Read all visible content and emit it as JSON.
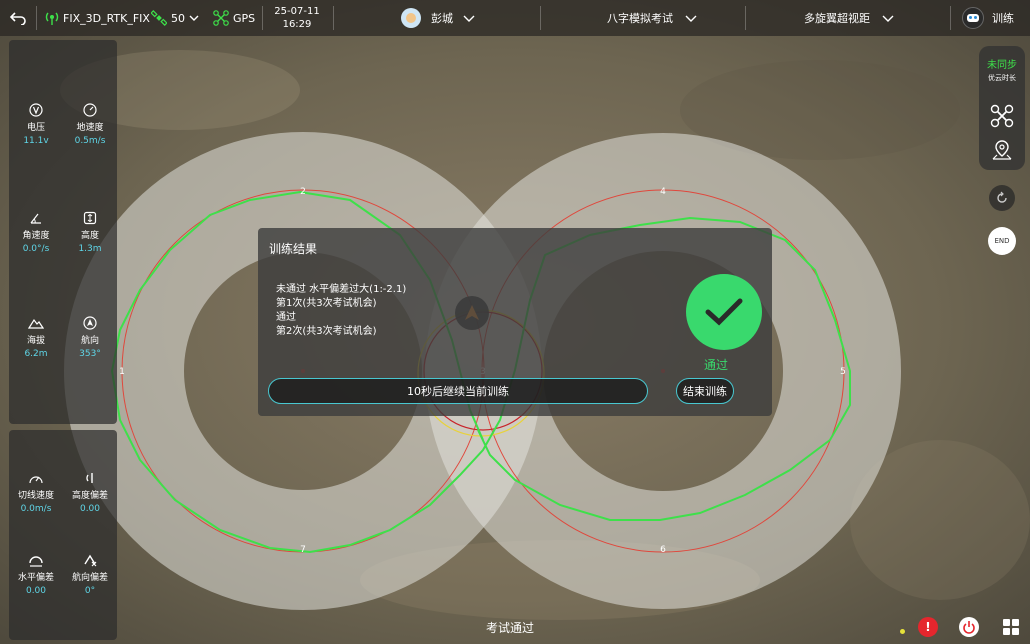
{
  "topbar": {
    "back_icon": "back-arrow-icon",
    "rtk_status": "FIX_3D_RTK_FIX",
    "satellite_count": "50",
    "gps_label": "GPS",
    "date": "25-07-11",
    "time": "16:29",
    "user_name": "彭城",
    "exam_mode": "八字模拟考试",
    "drone_view": "多旋翼超视距",
    "training_label": "训练"
  },
  "left_panel_top": [
    {
      "label": "电压",
      "value": "11.1v",
      "icon": "voltage-icon"
    },
    {
      "label": "地速度",
      "value": "0.5m/s",
      "icon": "speedometer-icon"
    },
    {
      "label": "角速度",
      "value": "0.0°/s",
      "icon": "angle-icon"
    },
    {
      "label": "高度",
      "value": "1.3m",
      "icon": "height-icon"
    },
    {
      "label": "海拔",
      "value": "6.2m",
      "icon": "mountain-icon"
    },
    {
      "label": "航向",
      "value": "353°",
      "icon": "heading-icon"
    }
  ],
  "left_panel_bottom": [
    {
      "label": "切线速度",
      "value": "0.0m/s",
      "icon": "tangent-speed-icon"
    },
    {
      "label": "高度偏差",
      "value": "0.00",
      "icon": "height-deviation-icon"
    },
    {
      "label": "水平偏差",
      "value": "0.00",
      "icon": "horizontal-deviation-icon"
    },
    {
      "label": "航向偏差",
      "value": "0°",
      "icon": "heading-deviation-icon"
    }
  ],
  "right_panel": {
    "sync_status": "未同步",
    "sync_sub": "优云时长",
    "end_label": "END"
  },
  "map": {
    "markers": [
      "1",
      "2",
      "3",
      "4",
      "5",
      "6",
      "7"
    ]
  },
  "dialog": {
    "title": "训练结果",
    "lines": [
      "未通过 水平偏差过大(1:-2.1)",
      "第1次(共3次考试机会)",
      "通过",
      "第2次(共3次考试机会)"
    ],
    "pass_label": "通过",
    "continue_button": "10秒后继续当前训练",
    "end_button": "结束训练"
  },
  "footer": {
    "status": "考试通过"
  },
  "colors": {
    "accent_cyan": "#5fd6e8",
    "pass_green": "#39d96d",
    "path_green": "#3ee04a",
    "ref_red": "#e0473c",
    "warning_red": "#e5262d"
  }
}
